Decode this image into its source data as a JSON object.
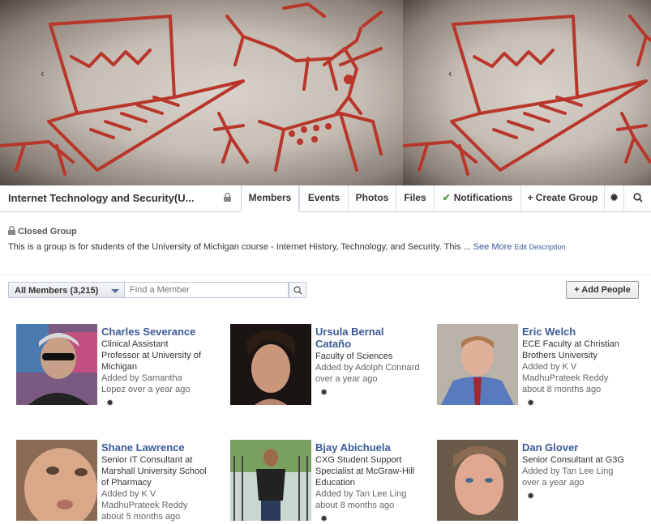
{
  "group": {
    "title": "Internet Technology and Security(U...",
    "privacy": "Closed Group",
    "description": "This is a group is for students of the University of Michigan course - Internet History, Technology, and Security. This ...",
    "see_more": "See More",
    "edit_description": "Edit Description"
  },
  "tabs": {
    "members": "Members",
    "events": "Events",
    "photos": "Photos",
    "files": "Files",
    "notifications": "Notifications",
    "create_group": "Create Group"
  },
  "icons": {
    "lock": "lock-icon",
    "check": "✔",
    "plus": "+",
    "gear": "✹",
    "search": "search-icon",
    "arrow_left": "‹"
  },
  "members_filter": {
    "selected": "All Members (3,215)",
    "search_placeholder": "Find a Member",
    "add_people": "Add People"
  },
  "members": [
    {
      "name": "Charles Severance",
      "title": "Clinical Assistant Professor at University of Michigan",
      "added": "Added by Samantha Lopez over a year ago"
    },
    {
      "name": "Ursula Bernal Cataño",
      "title": "Faculty of Sciences",
      "added": "Added by Adolph Connard over a year ago"
    },
    {
      "name": "Eric Welch",
      "title": "ECE Faculty at Christian Brothers University",
      "added": "Added by K V MadhuPrateek Reddy about 8 months ago"
    },
    {
      "name": "Shane Lawrence",
      "title": "Senior IT Consultant at Marshall University School of Pharmacy",
      "added": "Added by K V MadhuPrateek Reddy about 5 months ago"
    },
    {
      "name": "Bjay Abichuela",
      "title": "CXG Student Support Specialist at McGraw-Hill Education",
      "added": "Added by Tan Lee Ling about 8 months ago"
    },
    {
      "name": "Dan Glover",
      "title": "Senior Consultant at G3G",
      "added": "Added by Tan Lee Ling over a year ago"
    }
  ],
  "colors": {
    "link": "#3b5998",
    "check": "#4a9a3e",
    "border": "#c4cde0",
    "cave_paint": "#b8372a"
  }
}
